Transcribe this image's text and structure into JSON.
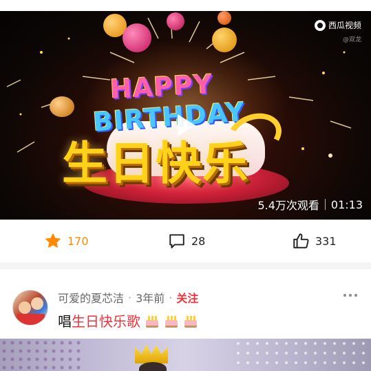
{
  "video": {
    "logo_text": "西瓜视频",
    "watermark": "@双龙",
    "overlay_happy": "HAPPY",
    "overlay_birthday": "BIRTHDAY",
    "overlay_cn": "生日快乐",
    "views": "5.4万次观看",
    "duration": "01:13"
  },
  "actions": {
    "favorite_count": "170",
    "comment_count": "28",
    "like_count": "331",
    "favorite_color": "#ff8a00"
  },
  "post": {
    "author": "可爱的夏芯洁",
    "time": "3年前",
    "follow_label": "关注",
    "title_prefix": "唱",
    "title_highlight": "生日快乐歌",
    "accent_color": "#f0323c"
  }
}
